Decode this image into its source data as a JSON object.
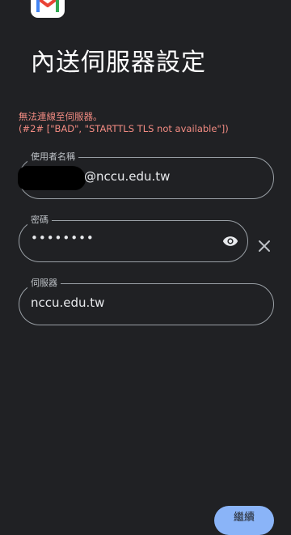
{
  "app": {
    "logo_icon": "gmail-logo-icon"
  },
  "page": {
    "title": "內送伺服器設定"
  },
  "error": {
    "line1": "無法連線至伺服器。",
    "line2": "(#2# [\"BAD\", \"STARTTLS TLS not available\"])",
    "color": "#f28b82"
  },
  "fields": {
    "username": {
      "label": "使用者名稱",
      "value": "@nccu.edu.tw"
    },
    "password": {
      "label": "密碼",
      "value": "••••••••",
      "toggle_icon": "eye-icon"
    },
    "server": {
      "label": "伺服器",
      "value": "nccu.edu.tw"
    }
  },
  "clear_icon": "close-icon",
  "next_button": {
    "label": "繼續"
  },
  "colors": {
    "background": "#202124",
    "accent": "#8ab4f8"
  }
}
